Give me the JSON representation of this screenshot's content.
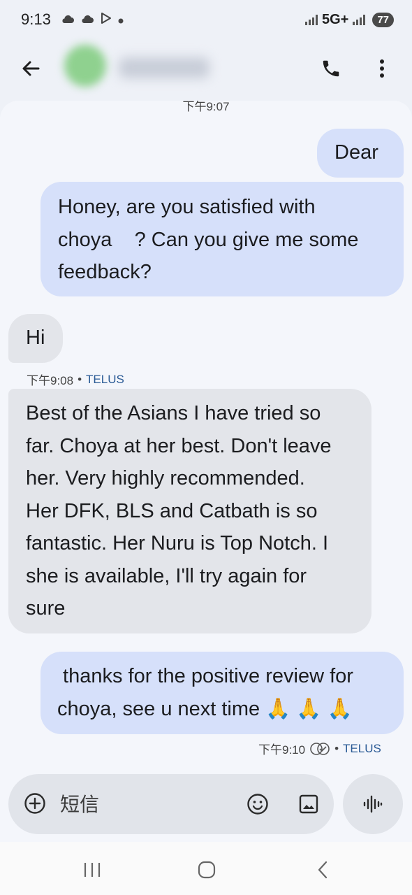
{
  "status_bar": {
    "time": "9:13",
    "icons": [
      "cloud-icon",
      "cloud-icon",
      "play-store-icon",
      "dot-icon"
    ],
    "network": "5G+",
    "battery": "77"
  },
  "header": {
    "back_icon": "arrow-left-icon",
    "contact_name": "",
    "call_icon": "phone-icon",
    "menu_icon": "more-vert-icon"
  },
  "conversation": {
    "cut_timestamp": "下午9:07",
    "messages": [
      {
        "direction": "outgoing",
        "text": "Dear"
      },
      {
        "direction": "outgoing",
        "lines": [
          "Honey, are you satisfied with",
          "choya    ? Can you give me some",
          "feedback?"
        ]
      },
      {
        "direction": "incoming",
        "text": "Hi"
      },
      {
        "direction": "incoming",
        "lines": [
          "Best of the Asians I have tried so",
          "far. Choya at her best. Don't leave",
          "her. Very highly recommended.",
          "Her DFK, BLS and Catbath is so",
          "fantastic. Her Nuru is Top Notch. I",
          "she is available, I'll try again for",
          "sure"
        ]
      },
      {
        "direction": "outgoing",
        "lines": [
          " thanks for the positive review for",
          "choya, see u next time "
        ],
        "emoji": "🙏 🙏 🙏"
      }
    ],
    "meta_incoming": {
      "time": "下午9:08",
      "separator": "•",
      "carrier": "TELUS"
    },
    "meta_outgoing": {
      "time": "下午9:10",
      "status_icon": "read-receipt-icon",
      "separator": "•",
      "carrier": "TELUS"
    }
  },
  "composer": {
    "placeholder": "短信",
    "add_icon": "add-circle-icon",
    "emoji_icon": "emoji-icon",
    "gallery_icon": "image-icon",
    "voice_icon": "voice-wave-icon"
  },
  "nav_bar": {
    "icons": [
      "recent-apps-icon",
      "home-icon",
      "back-icon"
    ]
  },
  "colors": {
    "outgoing_bubble": "#d6e0fa",
    "incoming_bubble": "#e3e5ea",
    "background": "#f4f6fb",
    "carrier_text": "#2a5a95"
  }
}
